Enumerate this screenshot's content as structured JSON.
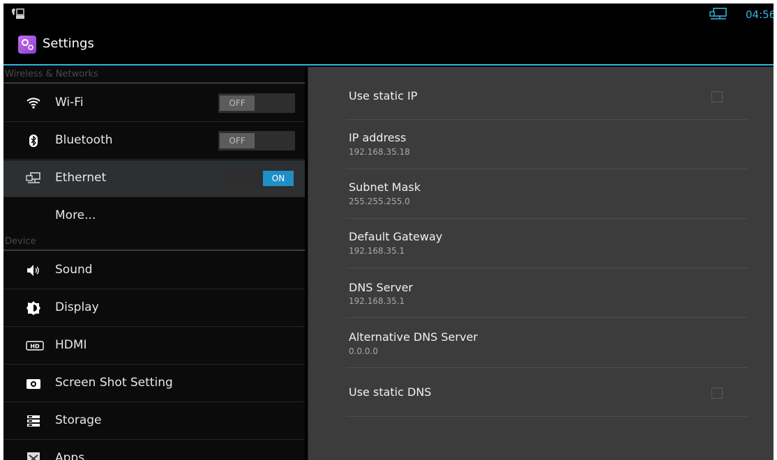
{
  "status_bar": {
    "left_icon": "phone-ethernet-icon",
    "ethernet_icon": "ethernet-connected-icon",
    "time": "04:56"
  },
  "action_bar": {
    "app_icon": "settings-app-icon",
    "title": "Settings"
  },
  "sidebar": {
    "categories": [
      "Wireless & Networks",
      "Device"
    ],
    "items": [
      {
        "label": "Wi-Fi",
        "icon": "wifi-icon",
        "toggle": "OFF"
      },
      {
        "label": "Bluetooth",
        "icon": "bluetooth-icon",
        "toggle": "OFF"
      },
      {
        "label": "Ethernet",
        "icon": "ethernet-icon",
        "toggle": "ON",
        "selected": true
      },
      {
        "label": "More..."
      },
      {
        "label": "Sound",
        "icon": "speaker-icon"
      },
      {
        "label": "Display",
        "icon": "brightness-icon"
      },
      {
        "label": "HDMI",
        "icon": "hdmi-icon"
      },
      {
        "label": "Screen Shot Setting",
        "icon": "camera-icon"
      },
      {
        "label": "Storage",
        "icon": "storage-icon"
      },
      {
        "label": "Apps",
        "icon": "apps-icon"
      }
    ]
  },
  "ethernet": {
    "rows": [
      {
        "title": "Use static IP",
        "checkbox": false
      },
      {
        "title": "IP address",
        "value": "192.168.35.18"
      },
      {
        "title": "Subnet Mask",
        "value": "255.255.255.0"
      },
      {
        "title": "Default Gateway",
        "value": "192.168.35.1"
      },
      {
        "title": "DNS Server",
        "value": "192.168.35.1"
      },
      {
        "title": "Alternative DNS Server",
        "value": "0.0.0.0"
      },
      {
        "title": "Use static DNS",
        "checkbox": false
      }
    ]
  },
  "colors": {
    "accent": "#33b5e5",
    "toggle_on": "#1f8fc8",
    "right_pane_bg": "#3c3c3c",
    "selected_item_bg": "#2c3032"
  }
}
